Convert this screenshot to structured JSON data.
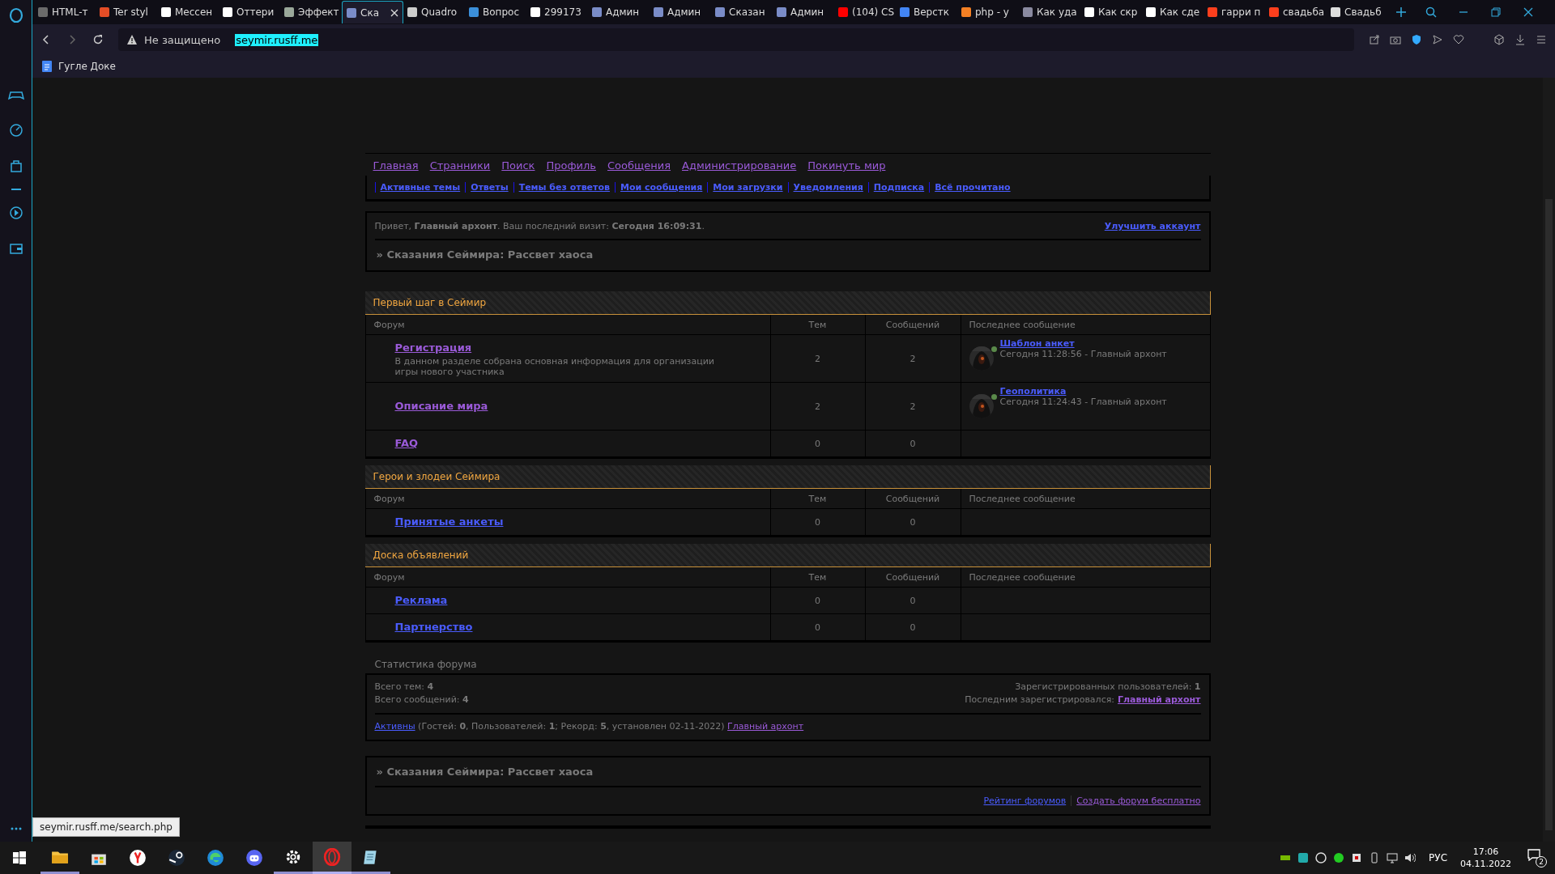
{
  "browser": {
    "tabs": [
      {
        "title": "HTML-т",
        "selected": false,
        "color": "#6b6b6b"
      },
      {
        "title": "Ter styl",
        "selected": false,
        "color": "#e44d26"
      },
      {
        "title": "Мессен",
        "selected": false,
        "color": "#ffffff"
      },
      {
        "title": "Оттери",
        "selected": false,
        "color": "#ffffff"
      },
      {
        "title": "Эффект",
        "selected": false,
        "color": "#9aa89a"
      },
      {
        "title": "Ска",
        "selected": true,
        "color": "#7a8cc8"
      },
      {
        "title": "Quadro",
        "selected": false,
        "color": "#cccccc"
      },
      {
        "title": "Вопрос",
        "selected": false,
        "color": "#3b8fd9"
      },
      {
        "title": "299173",
        "selected": false,
        "color": "#ffffff"
      },
      {
        "title": "Админ",
        "selected": false,
        "color": "#7a8cc8"
      },
      {
        "title": "Админ",
        "selected": false,
        "color": "#7a8cc8"
      },
      {
        "title": "Сказан",
        "selected": false,
        "color": "#7a8cc8"
      },
      {
        "title": "Админ",
        "selected": false,
        "color": "#7a8cc8"
      },
      {
        "title": "(104) CS",
        "selected": false,
        "color": "#ff0000"
      },
      {
        "title": "Верстк",
        "selected": false,
        "color": "#4285f4"
      },
      {
        "title": "php - у",
        "selected": false,
        "color": "#f48024"
      },
      {
        "title": "Как уда",
        "selected": false,
        "color": "#8a8aa0"
      },
      {
        "title": "Как скр",
        "selected": false,
        "color": "#ffffff"
      },
      {
        "title": "Как сде",
        "selected": false,
        "color": "#ffffff"
      },
      {
        "title": "гарри п",
        "selected": false,
        "color": "#fc3f1d"
      },
      {
        "title": "свадьба",
        "selected": false,
        "color": "#fc3f1d"
      },
      {
        "title": "Свадьб",
        "selected": false,
        "color": "#dddddd"
      }
    ],
    "address_bar": {
      "security": "Не защищено",
      "url": "seymir.rusff.me"
    },
    "bookmarks": [
      {
        "title": "Гугле Доке"
      }
    ],
    "status_url": "seymir.rusff.me/search.php"
  },
  "forum": {
    "main_nav": [
      {
        "label": "Главная",
        "visited": true
      },
      {
        "label": "Странники",
        "visited": true
      },
      {
        "label": "Поиск",
        "visited": true
      },
      {
        "label": "Профиль",
        "visited": true
      },
      {
        "label": "Сообщения",
        "visited": true
      },
      {
        "label": "Администрирование",
        "visited": true
      },
      {
        "label": "Покинуть мир",
        "visited": true
      }
    ],
    "sub_nav": [
      {
        "label": "Активные темы",
        "visited": false
      },
      {
        "label": "Ответы",
        "visited": false
      },
      {
        "label": "Темы без ответов",
        "visited": false
      },
      {
        "label": "Мои сообщения",
        "visited": false
      },
      {
        "label": "Мои загрузки",
        "visited": false
      },
      {
        "label": "Уведомления",
        "visited": false
      },
      {
        "label": "Подписка",
        "visited": false
      },
      {
        "label": "Всё прочитано",
        "visited": false
      }
    ],
    "welcome": {
      "greeting": "Привет, **Главный архонт**.  Ваш последний визит: **Сегодня 16:09:31**.",
      "upgrade_link": "Улучшить аккаунт"
    },
    "title": "» Сказания Сеймира: Рассвет хаоса",
    "categories": [
      {
        "title": "Первый шаг в Сеймир",
        "columns": [
          "Форум",
          "Тем",
          "Сообщений",
          "Последнее сообщение"
        ],
        "forums": [
          {
            "name": "Регистрация",
            "visited": true,
            "description": "В данном разделе собрана основная информация для организации игры нового участника",
            "topics": "2",
            "posts": "2",
            "last_post": {
              "title": "Шаблон анкет",
              "meta": "Сегодня 11:28:56 - Главный архонт",
              "online": true
            }
          },
          {
            "name": "Описание мира",
            "visited": true,
            "topics": "2",
            "posts": "2",
            "last_post": {
              "title": "Геополитика",
              "meta": "Сегодня 11:24:43 - Главный архонт",
              "online": true
            }
          },
          {
            "name": "FAQ",
            "visited": true,
            "topics": "0",
            "posts": "0"
          }
        ]
      },
      {
        "title": "Герои и злодеи Сеймира",
        "columns": [
          "Форум",
          "Тем",
          "Сообщений",
          "Последнее сообщение"
        ],
        "forums": [
          {
            "name": "Принятые анкеты",
            "visited": false,
            "topics": "0",
            "posts": "0"
          }
        ]
      },
      {
        "title": "Доска объявлений",
        "columns": [
          "Форум",
          "Тем",
          "Сообщений",
          "Последнее сообщение"
        ],
        "forums": [
          {
            "name": "Реклама",
            "visited": false,
            "topics": "0",
            "posts": "0"
          },
          {
            "name": "Партнерство",
            "visited": false,
            "topics": "0",
            "posts": "0"
          }
        ]
      }
    ],
    "stats": {
      "title": "Статистика форума",
      "total_topics": "Всего тем: **4**",
      "total_posts": "Всего сообщений: **4**",
      "registered": "Зарегистрированных пользователей: **1**",
      "last_registered": "Последним зарегистрировался:",
      "last_registered_user": {
        "label": "Главный архонт",
        "visited": true
      },
      "online_link": {
        "label": "Активны",
        "visited": false
      },
      "online_text": "(Гостей: **0**, Пользователей: **1**; Рекорд: **5**, установлен 02-11-2022)",
      "online_user": {
        "label": "Главный архонт",
        "visited": true
      }
    },
    "footer": {
      "title": "» Сказания Сеймира: Рассвет хаоса",
      "links": [
        {
          "label": "Рейтинг форумов",
          "visited": false
        },
        {
          "label": "Создать форум бесплатно",
          "visited": true
        }
      ]
    }
  },
  "taskbar": {
    "apps": [
      {
        "kind": "explorer",
        "running": true,
        "selected": false
      },
      {
        "kind": "store",
        "running": false,
        "selected": false
      },
      {
        "kind": "yandex",
        "running": false,
        "selected": false
      },
      {
        "kind": "steam",
        "running": false,
        "selected": false
      },
      {
        "kind": "edge",
        "running": false,
        "selected": false
      },
      {
        "kind": "discord",
        "running": false,
        "selected": false
      },
      {
        "kind": "settings",
        "running": true,
        "selected": false
      },
      {
        "kind": "opera",
        "running": true,
        "selected": true
      },
      {
        "kind": "notes",
        "running": true,
        "selected": false
      }
    ],
    "language": "РУС",
    "time": "17:06",
    "date": "04.11.2022",
    "notifications": "2"
  }
}
